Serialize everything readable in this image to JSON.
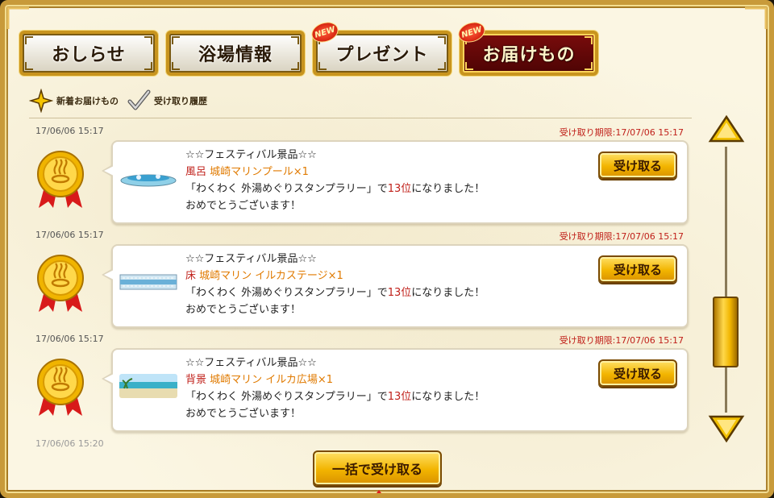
{
  "tabs": [
    {
      "label": "おしらせ",
      "new": false,
      "active": false
    },
    {
      "label": "浴場情報",
      "new": false,
      "active": false
    },
    {
      "label": "プレゼント",
      "new": true,
      "active": false
    },
    {
      "label": "お届けもの",
      "new": true,
      "active": true
    }
  ],
  "new_badge_label": "NEW",
  "legend": {
    "new_label": "新着お届けもの",
    "history_label": "受け取り履歴"
  },
  "items": [
    {
      "date": "17/06/06 15:17",
      "expire": "受け取り期限:17/07/06 15:17",
      "title": "☆☆フェスティバル景品☆☆",
      "category": "風呂",
      "item_name": "城崎マリンプール×1",
      "message_prefix": "「わくわく 外湯めぐりスタンプラリー」で",
      "rank": "13位",
      "message_suffix": "になりました！",
      "message_line2": "おめでとうございます！",
      "button_label": "受け取る"
    },
    {
      "date": "17/06/06 15:17",
      "expire": "受け取り期限:17/07/06 15:17",
      "title": "☆☆フェスティバル景品☆☆",
      "category": "床",
      "item_name": "城崎マリン イルカステージ×1",
      "message_prefix": "「わくわく 外湯めぐりスタンプラリー」で",
      "rank": "13位",
      "message_suffix": "になりました！",
      "message_line2": "おめでとうございます！",
      "button_label": "受け取る"
    },
    {
      "date": "17/06/06 15:17",
      "expire": "受け取り期限:17/07/06 15:17",
      "title": "☆☆フェスティバル景品☆☆",
      "category": "背景",
      "item_name": "城崎マリン イルカ広場×1",
      "message_prefix": "「わくわく 外湯めぐりスタンプラリー」で",
      "rank": "13位",
      "message_suffix": "になりました！",
      "message_line2": "おめでとうございます！",
      "button_label": "受け取る"
    }
  ],
  "next_date": "17/06/06 15:20",
  "bulk_button_label": "一括で受け取る",
  "colors": {
    "gold": "#f2b400",
    "frame": "#c89a3a",
    "active_tab": "#7a0c0c",
    "red_text": "#c0201a",
    "orange_text": "#e07a00"
  }
}
